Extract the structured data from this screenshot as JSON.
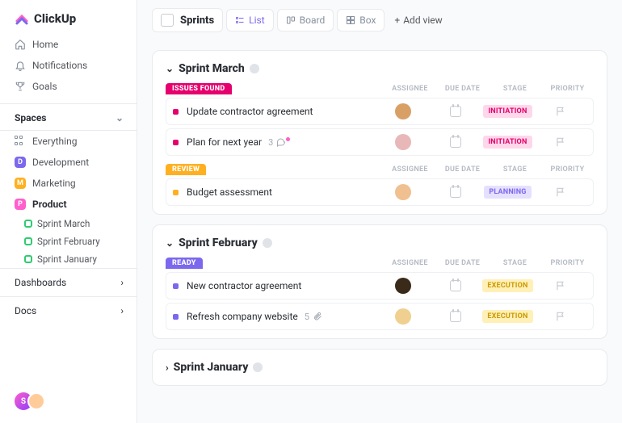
{
  "brand": "ClickUp",
  "nav": {
    "home": "Home",
    "notifications": "Notifications",
    "goals": "Goals"
  },
  "spaces": {
    "header": "Spaces",
    "everything": "Everything",
    "items": [
      {
        "label": "Development",
        "color": "#7b68ee",
        "initial": "D"
      },
      {
        "label": "Marketing",
        "color": "#ffb020",
        "initial": "M"
      },
      {
        "label": "Product",
        "color": "#ff5ecc",
        "initial": "P"
      }
    ],
    "sub": [
      "Sprint  March",
      "Sprint  February",
      "Sprint January"
    ]
  },
  "sections": {
    "dashboards": "Dashboards",
    "docs": "Docs"
  },
  "footer_avatar": "S",
  "breadcrumb": {
    "title": "Sprints"
  },
  "views": {
    "list": "List",
    "board": "Board",
    "box": "Box",
    "add": "Add view"
  },
  "col_headers": {
    "assignee": "ASSIGNEE",
    "due": "DUE DATE",
    "stage": "STAGE",
    "priority": "PRIORITY"
  },
  "sprints": [
    {
      "title": "Sprint March",
      "expanded": true,
      "groups": [
        {
          "label": "ISSUES FOUND",
          "color": "#e5006d",
          "tasks": [
            {
              "title": "Update contractor agreement",
              "stage": "INITIATION",
              "stage_bg": "#ffd7ea",
              "stage_color": "#e5006d",
              "dot": "#e5006d",
              "ava": "#d9a066"
            },
            {
              "title": "Plan for next year",
              "stage": "INITIATION",
              "stage_bg": "#ffd7ea",
              "stage_color": "#e5006d",
              "dot": "#e5006d",
              "ava": "#e8b8b8",
              "meta": "3",
              "meta_icon": "chat"
            }
          ]
        },
        {
          "label": "REVIEW",
          "color": "#ffb020",
          "tasks": [
            {
              "title": "Budget assessment",
              "stage": "PLANNING",
              "stage_bg": "#e6e0ff",
              "stage_color": "#7b68ee",
              "dot": "#ffb020",
              "ava": "#f0c090"
            }
          ]
        }
      ]
    },
    {
      "title": "Sprint February",
      "expanded": true,
      "groups": [
        {
          "label": "READY",
          "color": "#7b68ee",
          "tasks": [
            {
              "title": "New contractor agreement",
              "stage": "EXECUTION",
              "stage_bg": "#fff0b8",
              "stage_color": "#cc9a00",
              "dot": "#7b68ee",
              "ava": "#3a2a1a"
            },
            {
              "title": "Refresh company website",
              "stage": "EXECUTION",
              "stage_bg": "#fff0b8",
              "stage_color": "#cc9a00",
              "dot": "#7b68ee",
              "ava": "#f0d090",
              "meta": "5",
              "meta_icon": "clip"
            }
          ]
        }
      ]
    },
    {
      "title": "Sprint January",
      "expanded": false,
      "groups": []
    }
  ]
}
